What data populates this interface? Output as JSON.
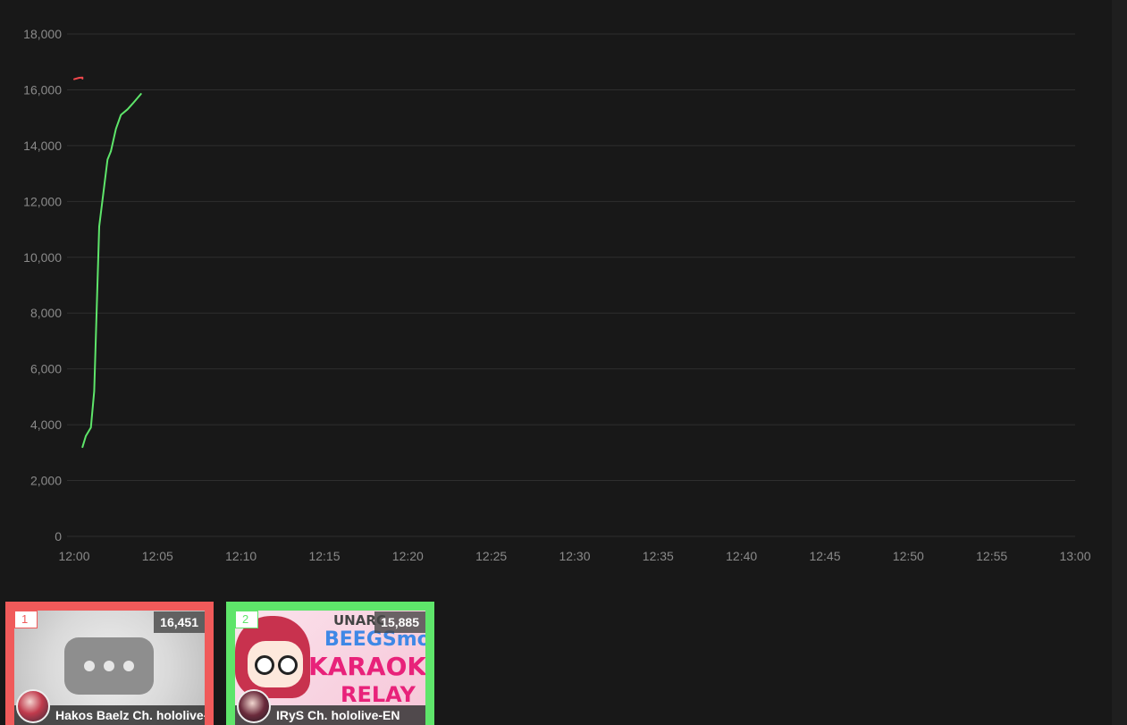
{
  "chart_data": {
    "type": "line",
    "title": "",
    "xlabel": "",
    "ylabel": "",
    "ylim": [
      0,
      18000
    ],
    "yticks": [
      0,
      2000,
      4000,
      6000,
      8000,
      10000,
      12000,
      14000,
      16000,
      18000
    ],
    "ytick_labels": [
      "0",
      "2,000",
      "4,000",
      "6,000",
      "8,000",
      "10,000",
      "12,000",
      "14,000",
      "16,000",
      "18,000"
    ],
    "xlim": [
      "12:00",
      "13:00"
    ],
    "xtick_labels": [
      "12:00",
      "12:05",
      "12:10",
      "12:15",
      "12:20",
      "12:25",
      "12:30",
      "12:35",
      "12:40",
      "12:45",
      "12:50",
      "12:55",
      "13:00"
    ],
    "grid": true,
    "series": [
      {
        "color": "#f0474c",
        "points": [
          [
            "12:00",
            16380
          ],
          [
            "12:00.3",
            16430
          ],
          [
            "12:00.5",
            16440
          ],
          [
            "12:00.5",
            16400
          ]
        ]
      },
      {
        "color": "#5ee56a",
        "points": [
          [
            "12:00.5",
            3200
          ],
          [
            "12:00.7",
            3600
          ],
          [
            "12:01",
            3900
          ],
          [
            "12:01.2",
            5200
          ],
          [
            "12:01.5",
            11100
          ],
          [
            "12:02",
            13500
          ],
          [
            "12:02.2",
            13800
          ],
          [
            "12:02.5",
            14600
          ],
          [
            "12:02.8",
            15100
          ],
          [
            "12:03.2",
            15300
          ],
          [
            "12:03.5",
            15500
          ],
          [
            "12:04",
            15850
          ]
        ]
      }
    ]
  },
  "cards": [
    {
      "rank": "1",
      "count": "16,451",
      "channel": "Hakos Baelz Ch. hololive-",
      "border_color": "#f05a5a"
    },
    {
      "rank": "2",
      "count": "15,885",
      "channel": "IRyS Ch. hololive-EN",
      "border_color": "#5ee56a",
      "thumb_text": [
        "UNARC",
        "BEEGSmols",
        "KARAOKE",
        "RELAY"
      ]
    }
  ]
}
